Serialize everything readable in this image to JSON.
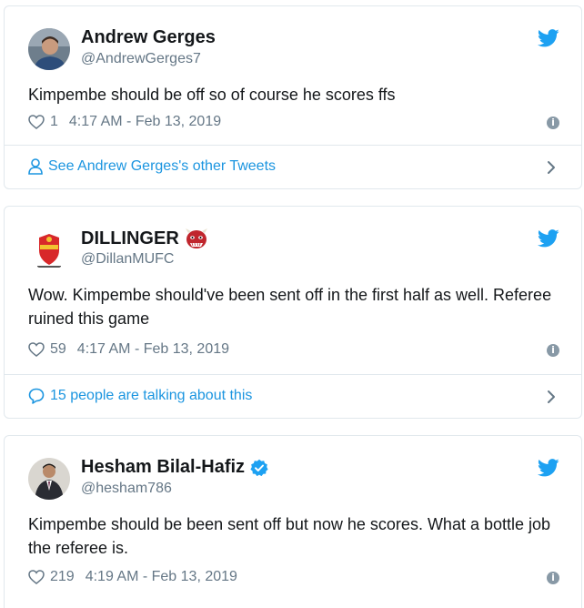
{
  "tweets": [
    {
      "name": "Andrew Gerges",
      "handle": "@AndrewGerges7",
      "text": "Kimpembe should be off so of course he scores ffs",
      "likes": "1",
      "timestamp": "4:17 AM - Feb 13, 2019",
      "footer_link": "See Andrew Gerges's other Tweets",
      "footer_icon": "person-icon",
      "verified": false
    },
    {
      "name": "DILLINGER",
      "handle": "@DillanMUFC",
      "text": "Wow. Kimpembe should've been sent off in the first half as well. Referee ruined this game",
      "likes": "59",
      "timestamp": "4:17 AM - Feb 13, 2019",
      "footer_link": "15 people are talking about this",
      "footer_icon": "speech-bubble-icon",
      "emoji": "ogre-emoji",
      "verified": false
    },
    {
      "name": "Hesham Bilal-Hafiz",
      "handle": "@hesham786",
      "text": "Kimpembe should be been sent off but now he scores. What a bottle job the referee is.",
      "likes": "219",
      "timestamp": "4:19 AM - Feb 13, 2019",
      "verified": true
    }
  ],
  "colors": {
    "twitter_blue": "#1da1f2",
    "link_blue": "#1b95e0",
    "muted": "#657786",
    "border": "#e1e8ed"
  }
}
